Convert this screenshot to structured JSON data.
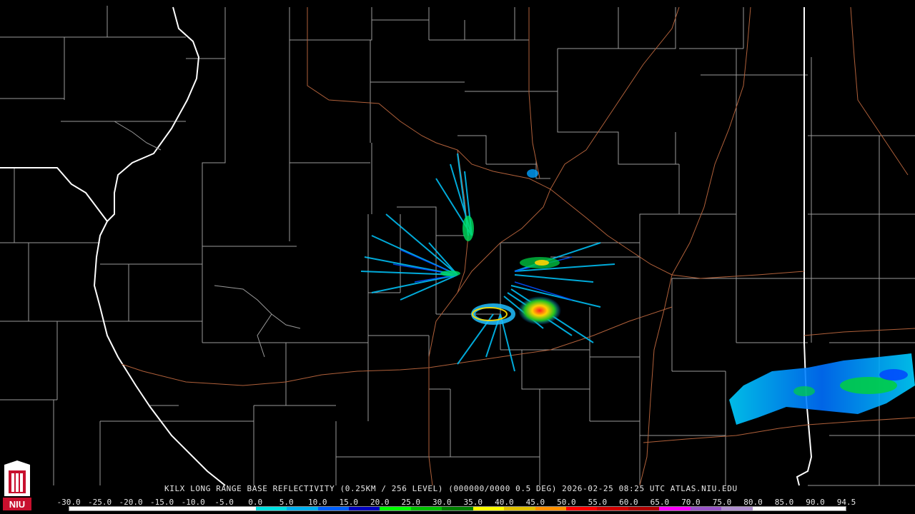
{
  "product": {
    "station": "KILX",
    "caption": "KILX LONG RANGE BASE REFLECTIVITY (0.25KM / 256 LEVEL) (000000/0000 0.5 DEG) 2026-02-25 08:25 UTC  ATLAS.NIU.EDU"
  },
  "logo": {
    "text": "NIU",
    "color": "#c8102e"
  },
  "scale": {
    "labels": [
      "-30.0",
      "-25.0",
      "-20.0",
      "-15.0",
      "-10.0",
      "-5.0",
      "0.0",
      "5.0",
      "10.0",
      "15.0",
      "20.0",
      "25.0",
      "30.0",
      "35.0",
      "40.0",
      "45.0",
      "50.0",
      "55.0",
      "60.0",
      "65.0",
      "70.0",
      "75.0",
      "80.0",
      "85.0",
      "90.0",
      "94.5"
    ],
    "colors": [
      "#ffffff",
      "#ffffff",
      "#ffffff",
      "#ffffff",
      "#ffffff",
      "#ffffff",
      "#00e0e0",
      "#00b0f0",
      "#0060ff",
      "#0000c0",
      "#00ff00",
      "#00c000",
      "#008000",
      "#ffff00",
      "#e0c000",
      "#ff9000",
      "#ff0000",
      "#d00000",
      "#b00000",
      "#ff00ff",
      "#9955c9",
      "#b090d0",
      "#ffffff",
      "#ffffff",
      "#ffffff"
    ]
  },
  "map": {
    "state_line_color": "#ffffff",
    "county_line_color": "#9a9a9a",
    "road_color": "#b0603a"
  }
}
